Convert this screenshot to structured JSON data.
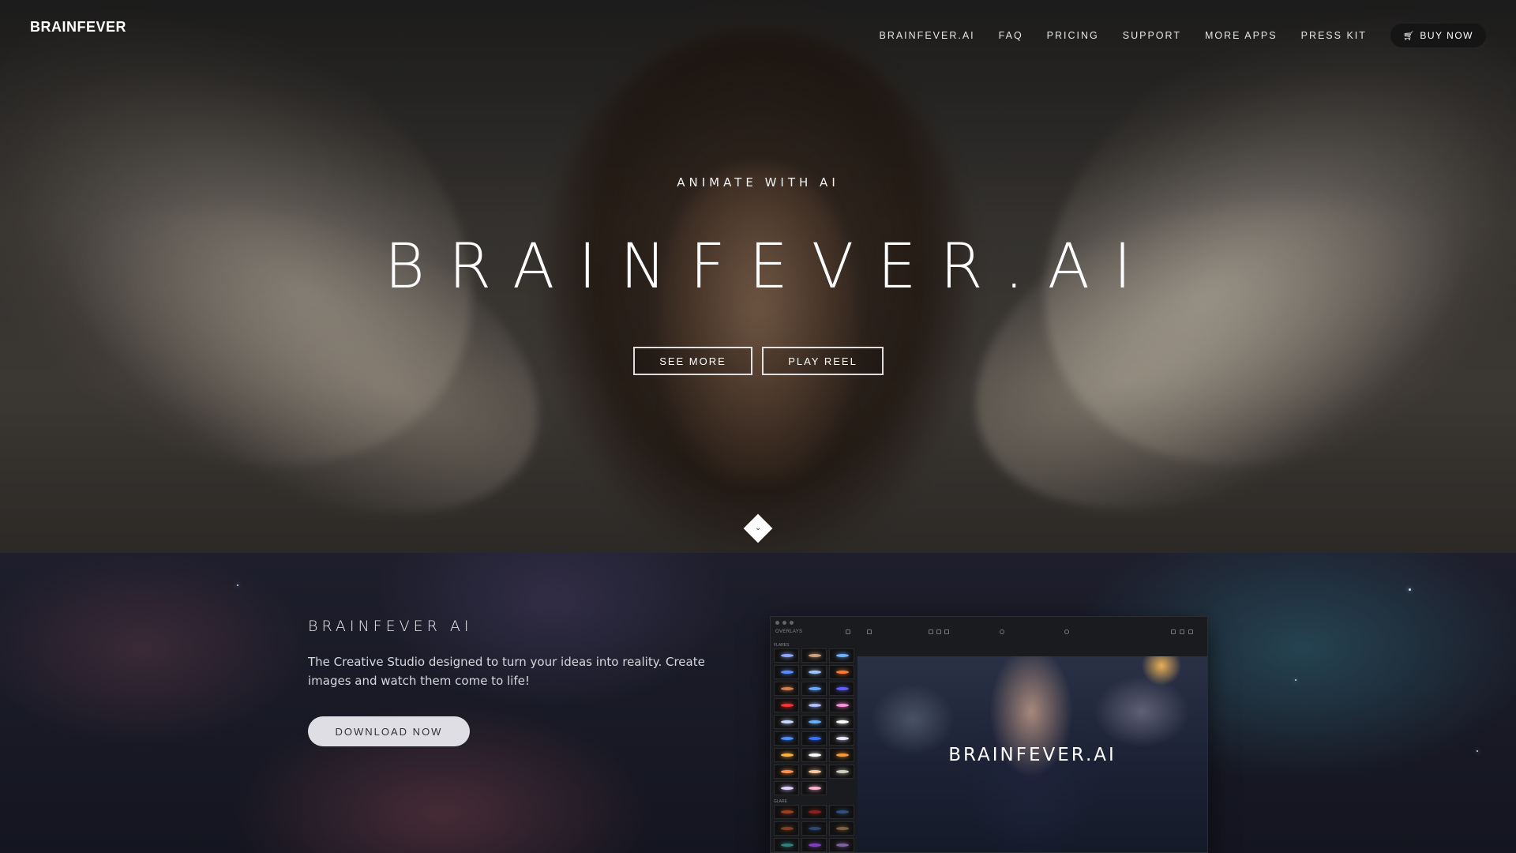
{
  "brand": {
    "logo": "BRAINFEVER"
  },
  "nav": {
    "links": [
      "BRAINFEVER.AI",
      "FAQ",
      "PRICING",
      "SUPPORT",
      "MORE APPS",
      "PRESS KIT"
    ],
    "buy_label": "BUY NOW"
  },
  "hero": {
    "eyebrow": "ANIMATE WITH AI",
    "title": "BRAINFEVER.AI",
    "buttons": {
      "see_more": "SEE MORE",
      "play_reel": "PLAY REEL"
    }
  },
  "feature": {
    "title": "BRAINFEVER AI",
    "body": "The Creative Studio designed to turn your ideas into reality. Create images and watch them come to life!",
    "download_label": "DOWNLOAD NOW"
  },
  "app_preview": {
    "panel_title": "OVERLAYS",
    "section_flares": "FLARES",
    "section_glare": "GLARE",
    "preview_text": "BRAINFEVER.AI"
  },
  "icons": [
    "cart-icon",
    "chevron-down-icon",
    "panel-icon",
    "home-icon",
    "zoom-icon",
    "undo-icon",
    "redo-icon",
    "settings-icon",
    "export-icon"
  ],
  "colors": {
    "buy_button_bg": "#151515",
    "download_button_bg": "#dedee4"
  }
}
